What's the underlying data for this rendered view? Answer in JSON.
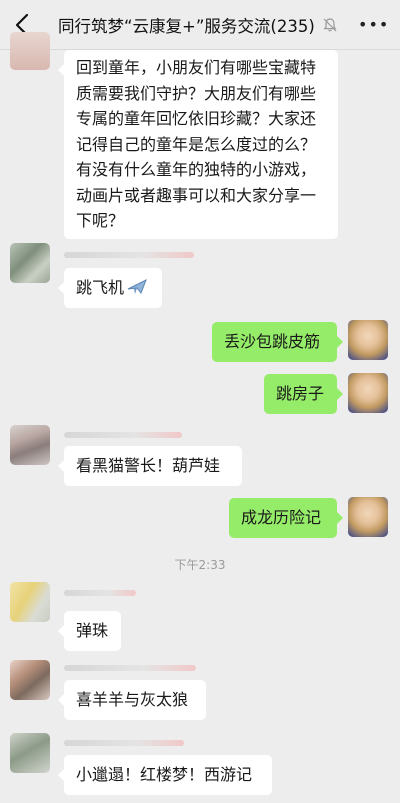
{
  "header": {
    "title": "同行筑梦“云康复+”服务交流(235)",
    "back_icon": "chevron-left-icon",
    "mute_icon": "bell-off-icon",
    "more_icon": "more-dots-icon"
  },
  "messages": [
    {
      "side": "in",
      "lines": [
        "回到童年，小朋友们有哪些宝藏特",
        "质需要我们守护？大朋友们有哪些",
        "专属的童年回忆依旧珍藏？大家还",
        "记得自己的童年是怎么度过的么？",
        "有没有什么童年的独特的小游戏，",
        "动画片或者趣事可以和大家分享一",
        "下呢？"
      ]
    },
    {
      "side": "in",
      "text": "跳飞机",
      "emoji": "airplane-icon"
    },
    {
      "side": "out",
      "text": "丢沙包跳皮筋"
    },
    {
      "side": "out",
      "text": "跳房子"
    },
    {
      "side": "in",
      "text": "看黑猫警长！葫芦娃"
    },
    {
      "side": "out",
      "text": "成龙历险记"
    },
    {
      "side": "in",
      "text": "弹珠"
    },
    {
      "side": "in",
      "text": "喜羊羊与灰太狼"
    },
    {
      "side": "in",
      "text": "小邋遢！红楼梦！西游记"
    }
  ],
  "timestamp": "下午2:33",
  "colors": {
    "background": "#ededed",
    "incoming_bubble": "#ffffff",
    "outgoing_bubble": "#95ec69",
    "timestamp_text": "#9a9a9a"
  }
}
